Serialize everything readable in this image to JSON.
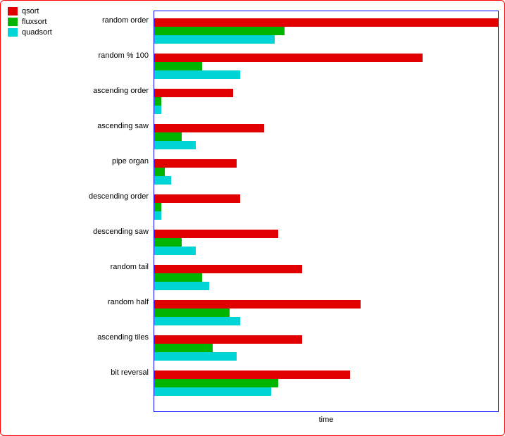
{
  "legend": {
    "items": [
      {
        "name": "qsort",
        "color": "#e00000"
      },
      {
        "name": "fluxsort",
        "color": "#00b400"
      },
      {
        "name": "quadsort",
        "color": "#00d4d4"
      }
    ]
  },
  "chart_data": {
    "type": "bar",
    "orientation": "horizontal",
    "xlabel": "time",
    "ylabel": "",
    "xlim": [
      0,
      100
    ],
    "categories": [
      "random order",
      "random % 100",
      "ascending order",
      "ascending saw",
      "pipe organ",
      "descending order",
      "descending saw",
      "random tail",
      "random half",
      "ascending tiles",
      "bit reversal"
    ],
    "series": [
      {
        "name": "qsort",
        "color": "#e00000",
        "values": [
          100,
          78,
          23,
          32,
          24,
          25,
          36,
          43,
          60,
          43,
          57
        ]
      },
      {
        "name": "fluxsort",
        "color": "#00b400",
        "values": [
          38,
          14,
          2,
          8,
          3,
          2,
          8,
          14,
          22,
          17,
          36
        ]
      },
      {
        "name": "quadsort",
        "color": "#00d4d4",
        "values": [
          35,
          25,
          2,
          12,
          5,
          2,
          12,
          16,
          25,
          24,
          34
        ]
      }
    ],
    "legend_position": "top-left",
    "grid": false
  }
}
